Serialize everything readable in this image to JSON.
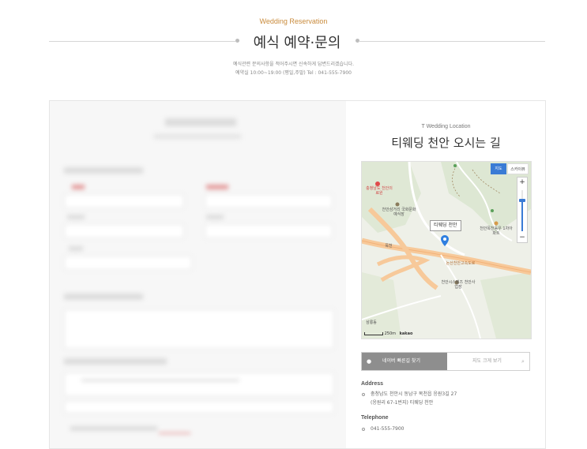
{
  "header": {
    "subtitle_en": "Wedding Reservation",
    "title": "예식 예약·문의",
    "desc_line1": "예식관련 문의사항을 적어주시면 신속하게 답변드리겠습니다.",
    "desc_line2": "예약실 10:00~19:00 (평일,주말) Tel : 041-555-7900"
  },
  "location": {
    "subtitle_en": "T Wedding Location",
    "title": "티웨딩 천안 오시는 길",
    "map": {
      "type_map_label": "지도",
      "type_sky_label": "스카이뷰",
      "zoom_in": "+",
      "zoom_out": "−",
      "zoom_level": 0.75,
      "callout": "티웨딩 천안",
      "scale_text": "250m",
      "brand": "kakao",
      "labels": {
        "l1": "충청남도 천안의료원",
        "l2": "천안삼거리 국화문화예식장",
        "l3": "천안목천동우 1차아파트",
        "l4": "천안시스템즈 천안사업장",
        "l5": "논산천안고속도로",
        "l6": "목천",
        "l7": "삼룡동"
      }
    },
    "route_button": "네이버 빠른길 찾기",
    "map_large_button": "지도 크게 보기",
    "address_heading": "Address",
    "address_line1": "충청남도 천안시 동남구 목천읍 응원3길 27",
    "address_line2": "(응원리 67-1번지) 티웨딩 천안",
    "telephone_heading": "Telephone",
    "telephone": "041-555-7900"
  },
  "colors": {
    "accent": "#c98b3c",
    "map_blue": "#3a7bd5",
    "route_gray": "#8e8e8e"
  }
}
